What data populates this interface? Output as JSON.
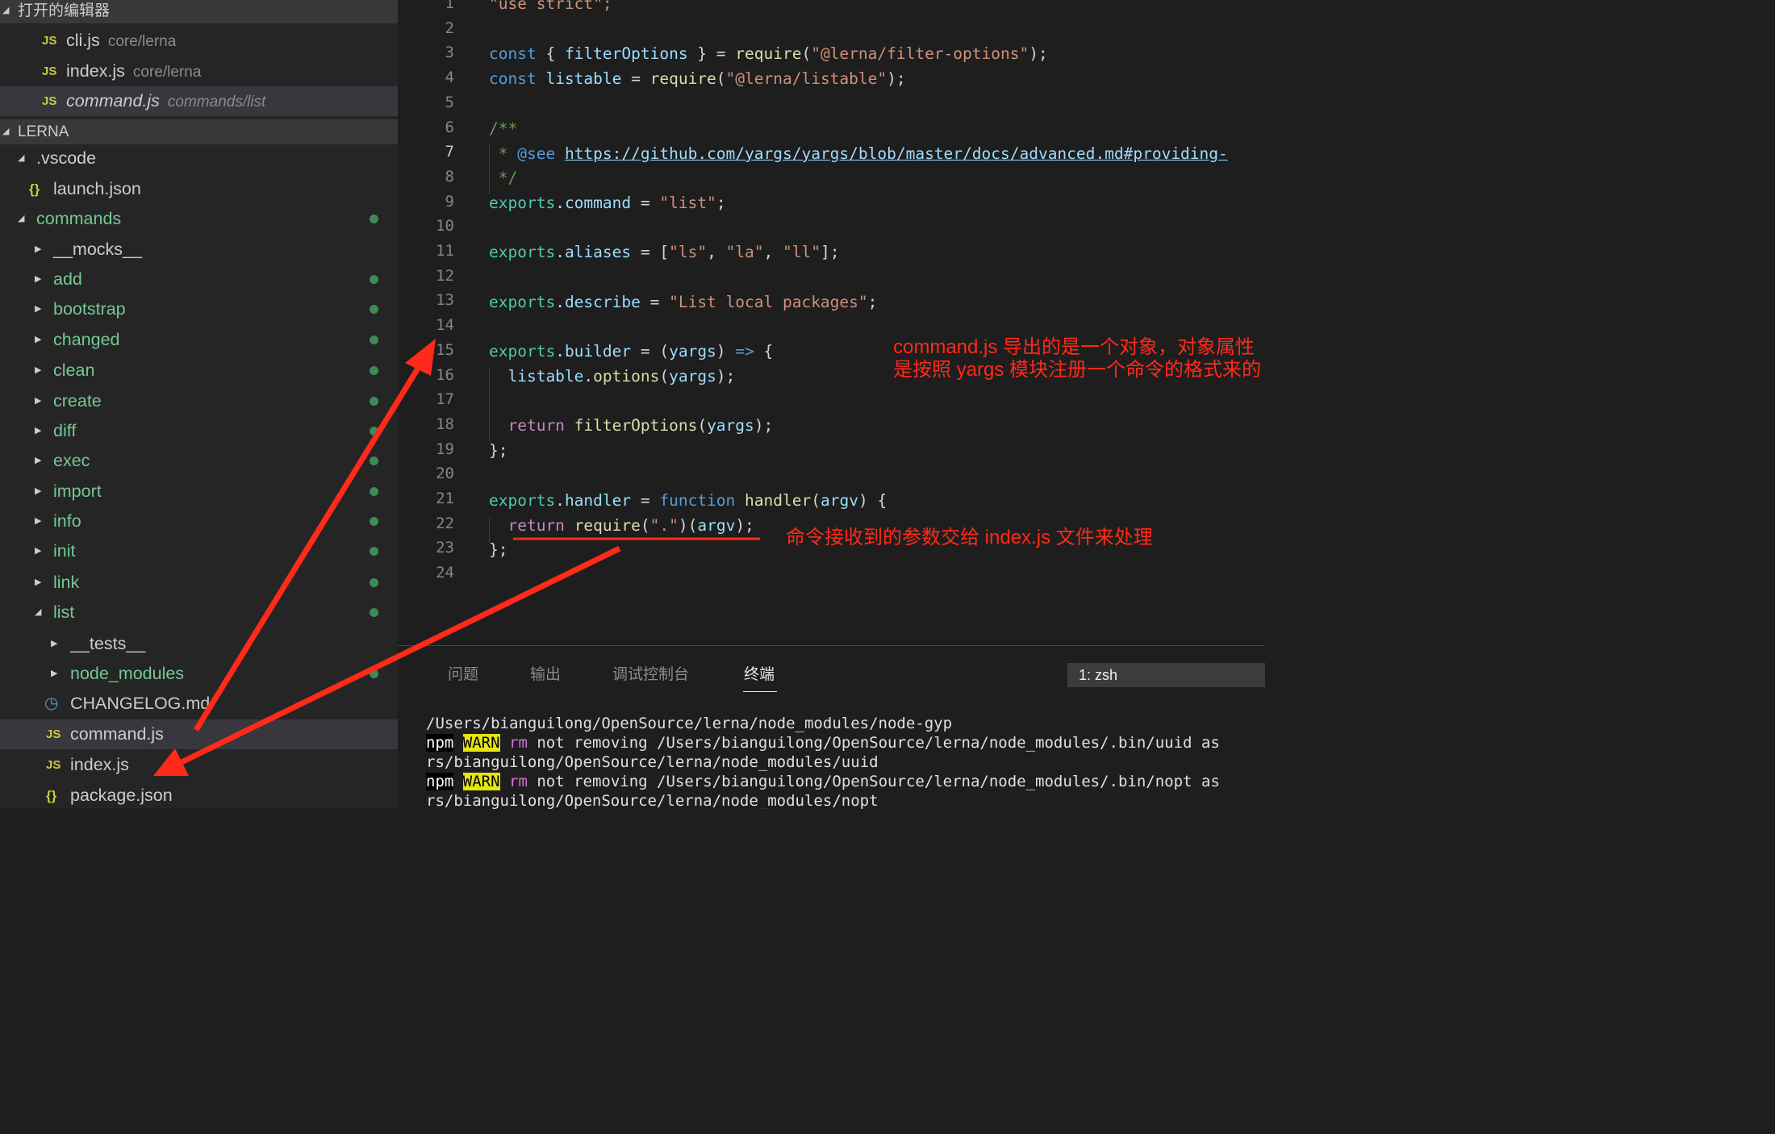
{
  "open_editors": {
    "header": "打开的编辑器",
    "files": [
      {
        "name": "cli.js",
        "path": "core/lerna",
        "icon": "JS"
      },
      {
        "name": "index.js",
        "path": "core/lerna",
        "icon": "JS"
      },
      {
        "name": "command.js",
        "path": "commands/list",
        "icon": "JS"
      }
    ]
  },
  "explorer": {
    "header": "LERNA",
    "items": [
      {
        "name": ".vscode"
      },
      {
        "name": "launch.json",
        "icon": "{}"
      },
      {
        "name": "commands"
      },
      {
        "name": "__mocks__"
      },
      {
        "name": "add"
      },
      {
        "name": "bootstrap"
      },
      {
        "name": "changed"
      },
      {
        "name": "clean"
      },
      {
        "name": "create"
      },
      {
        "name": "diff"
      },
      {
        "name": "exec"
      },
      {
        "name": "import"
      },
      {
        "name": "info"
      },
      {
        "name": "init"
      },
      {
        "name": "link"
      },
      {
        "name": "list"
      },
      {
        "name": "__tests__"
      },
      {
        "name": "node_modules"
      },
      {
        "name": "CHANGELOG.md"
      },
      {
        "name": "command.js",
        "icon": "JS"
      },
      {
        "name": "index.js",
        "icon": "JS"
      },
      {
        "name": "package.json",
        "icon": "{}"
      }
    ]
  },
  "editor": {
    "line_numbers": [
      "1",
      "2",
      "3",
      "4",
      "5",
      "6",
      "7",
      "8",
      "9",
      "10",
      "11",
      "12",
      "13",
      "14",
      "15",
      "16",
      "17",
      "18",
      "19",
      "20",
      "21",
      "22",
      "23",
      "24"
    ],
    "code": {
      "l1": "\"use strict\";",
      "l3_kw": "const",
      "l3_open": " { ",
      "l3_var": "filterOptions",
      "l3_mid": " } = ",
      "l3_fn": "require",
      "l3_p1": "(",
      "l3_str": "\"@lerna/filter-options\"",
      "l3_end": ");",
      "l4_kw": "const",
      "l4_var": "listable",
      "l4_eq": " = ",
      "l4_fn": "require",
      "l4_p1": "(",
      "l4_str": "\"@lerna/listable\"",
      "l4_end": ");",
      "l6": "/**",
      "l7_star": " * ",
      "l7_tag": "@see",
      "l7_link": "https://github.com/yargs/yargs/blob/master/docs/advanced.md#providing-",
      "l8": " */",
      "exports": "exports",
      "dot": ".",
      "l9_prop": "command",
      "eq": " = ",
      "l9_str": "\"list\"",
      "semi": ";",
      "l11_prop": "aliases",
      "l11_open": "[",
      "l11_s1": "\"ls\"",
      "comma": ", ",
      "l11_s2": "\"la\"",
      "l11_s3": "\"ll\"",
      "l11_close": "];",
      "l13_prop": "describe",
      "l13_str": "\"List local packages\"",
      "l15_prop": "builder",
      "l15_p1": " = (",
      "l15_arg": "yargs",
      "l15_p2": ") ",
      "l15_arrow": "=>",
      "l15_brace": " {",
      "l16_obj": "listable",
      "l16_fn": "options",
      "l16_p1": "(",
      "l16_arg": "yargs",
      "l16_end": ");",
      "l18_ret": "return",
      "l18_fn": "filterOptions",
      "l18_p1": "(",
      "l18_arg": "yargs",
      "l18_end": ");",
      "close": "};",
      "l21_prop": "handler",
      "l21_kw": "function",
      "l21_fn": "handler",
      "l21_p1": "(",
      "l21_arg": "argv",
      "l21_end": ") {",
      "l22_ret": "return",
      "l22_fn": "require",
      "l22_p1": "(",
      "l22_str": "\".\"",
      "l22_p2": ")(",
      "l22_arg": "argv",
      "l22_end": ");"
    },
    "annotations": {
      "note1": "command.js 导出的是一个对象，对象属性是按照 yargs 模块注册一个命令的格式来的",
      "note2": "命令接收到的参数交给 index.js 文件来处理"
    }
  },
  "panel": {
    "tabs": [
      "问题",
      "输出",
      "调试控制台",
      "终端"
    ],
    "terminal_selector": "1: zsh",
    "terminal": {
      "t1": "/Users/bianguilong/OpenSource/lerna/node_modules/node-gyp",
      "npm": "npm",
      "warn": "WARN",
      "rm": "rm",
      "t2_rest": " not removing /Users/bianguilong/OpenSource/lerna/node_modules/.bin/uuid as",
      "t3": "rs/bianguilong/OpenSource/lerna/node_modules/uuid",
      "t4_rest": " not removing /Users/bianguilong/OpenSource/lerna/node_modules/.bin/nopt as",
      "t5": "rs/bianguilong/OpenSource/lerna/node_modules/nopt"
    }
  },
  "colors": {
    "annotation": "#ff2a1a",
    "accent_green": "#73c991",
    "js_icon": "#cbcb41"
  }
}
